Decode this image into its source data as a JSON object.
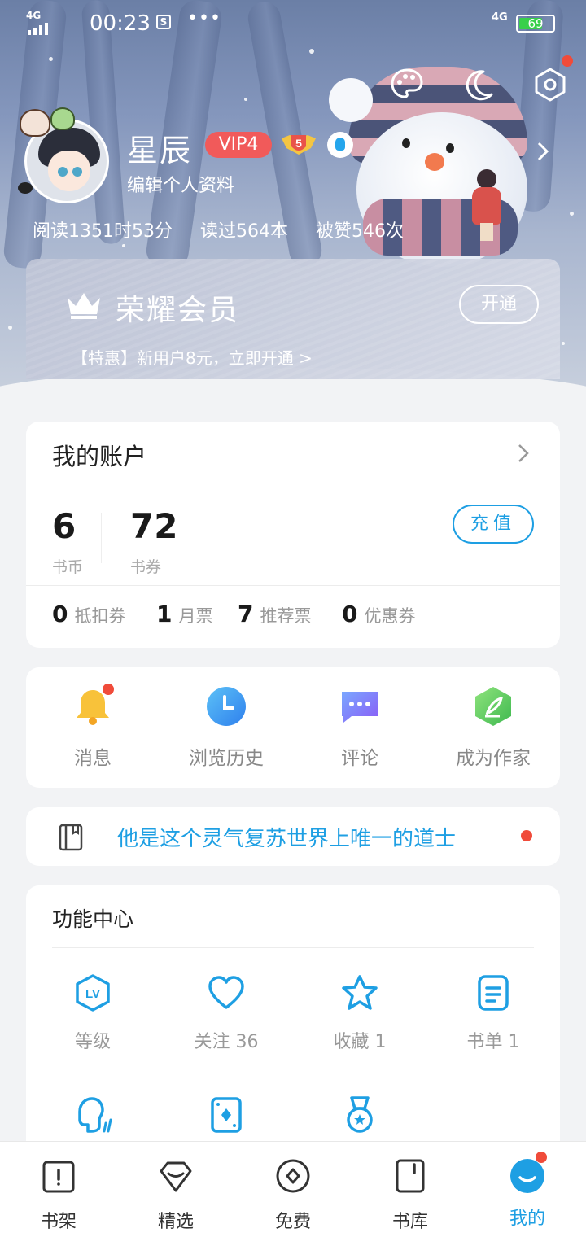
{
  "status_bar": {
    "network": "4G",
    "time": "00:23",
    "dots": "•••",
    "signal2": "4G",
    "battery": "69"
  },
  "profile": {
    "name": "星辰",
    "vip_level": "VIP4",
    "level_badge": "5",
    "edit_label": "编辑个人资料",
    "stats": [
      "阅读1351时53分",
      "读过564本",
      "被赞546次"
    ]
  },
  "vip_card": {
    "title": "荣耀会员",
    "open_label": "开通",
    "promo": "【特惠】新用户8元，立即开通 >"
  },
  "account": {
    "title": "我的账户",
    "coins_value": "6",
    "coins_label": "书币",
    "vouchers_value": "72",
    "vouchers_label": "书券",
    "recharge_label": "充值",
    "tickets": [
      {
        "value": "0",
        "label": "抵扣券"
      },
      {
        "value": "1",
        "label": "月票"
      },
      {
        "value": "7",
        "label": "推荐票"
      },
      {
        "value": "0",
        "label": "优惠券"
      }
    ]
  },
  "quick_actions": [
    {
      "label": "消息",
      "icon": "bell-icon"
    },
    {
      "label": "浏览历史",
      "icon": "clock-icon"
    },
    {
      "label": "评论",
      "icon": "comment-icon"
    },
    {
      "label": "成为作家",
      "icon": "pen-leaf-icon"
    }
  ],
  "recent_book": {
    "title": "他是这个灵气复苏世界上唯一的道士"
  },
  "function_center": {
    "title": "功能中心",
    "items": [
      {
        "label": "等级",
        "icon": "level-icon"
      },
      {
        "label": "关注 36",
        "icon": "heart-icon"
      },
      {
        "label": "收藏 1",
        "icon": "star-icon"
      },
      {
        "label": "书单 1",
        "icon": "booklist-icon"
      },
      {
        "label": "",
        "icon": "voice-icon"
      },
      {
        "label": "",
        "icon": "card-icon"
      },
      {
        "label": "",
        "icon": "medal-icon"
      }
    ]
  },
  "bottom_nav": [
    {
      "label": "书架",
      "icon": "bookshelf-icon"
    },
    {
      "label": "精选",
      "icon": "diamond-icon"
    },
    {
      "label": "免费",
      "icon": "coin-icon"
    },
    {
      "label": "书库",
      "icon": "library-icon"
    },
    {
      "label": "我的",
      "icon": "profile-icon",
      "active": true
    }
  ],
  "colors": {
    "accent": "#1e9fe3",
    "vip_red": "#f15a5a",
    "notify_red": "#f04b3a"
  }
}
